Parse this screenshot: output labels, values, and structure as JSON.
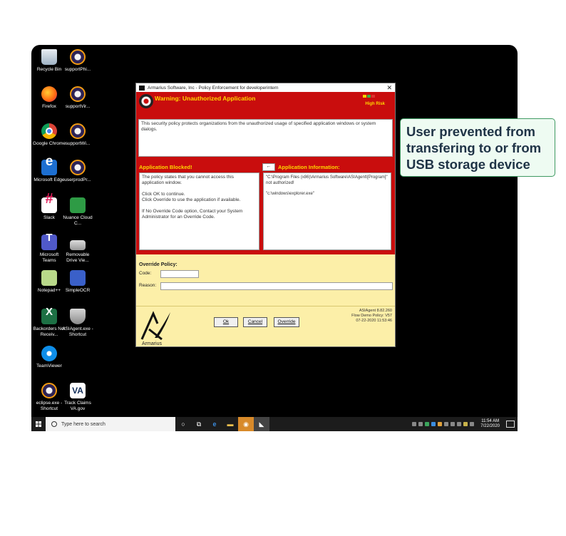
{
  "desktop": {
    "icons": [
      {
        "label": "Recycle Bin",
        "icon": "recycle-bin-icon"
      },
      {
        "label": "supportPhi...",
        "icon": "eclipse-icon"
      },
      {
        "label": "Firefox",
        "icon": "firefox-icon"
      },
      {
        "label": "supportVir...",
        "icon": "eclipse-icon"
      },
      {
        "label": "Google Chrome",
        "icon": "chrome-icon"
      },
      {
        "label": "supportWi...",
        "icon": "eclipse-icon"
      },
      {
        "label": "Microsoft Edge",
        "icon": "edge-icon"
      },
      {
        "label": "userprodPr...",
        "icon": "eclipse-icon"
      },
      {
        "label": "Slack",
        "icon": "slack-icon"
      },
      {
        "label": "Nuance Cloud C...",
        "icon": "nuance-icon"
      },
      {
        "label": "Microsoft Teams",
        "icon": "teams-icon"
      },
      {
        "label": "Removable Drive Vie...",
        "icon": "drive-icon"
      },
      {
        "label": "Notepad++",
        "icon": "notepad-icon"
      },
      {
        "label": "SimpleOCR",
        "icon": "ocr-icon"
      },
      {
        "label": "Backorders Not Receiv...",
        "icon": "excel-icon"
      },
      {
        "label": "ASIAgent.exe - Shortcut",
        "icon": "shield-icon"
      },
      {
        "label": "TeamViewer",
        "icon": "teamviewer-icon"
      },
      {
        "label": "eclipse.exe - Shortcut",
        "icon": "eclipse-icon"
      },
      {
        "label": "Track Claims VA.gov",
        "icon": "va-icon"
      }
    ]
  },
  "dialog": {
    "title": "Armarius Software, Inc - Policy Enforcement for developerintern",
    "close": "✕",
    "warning_title": "Warning: Unauthorized Application",
    "risk_label": "High Risk",
    "risk_colors": [
      "#f4d000",
      "#3cb043",
      "#e03030"
    ],
    "policy_text": "This security policy protects organizations from the unauthorized usage of specified application windows or system dialogs.",
    "blocked": {
      "header": "Application Blocked!",
      "line1": "The policy states that you cannot access this application window.",
      "line2": "Click OK to continue.",
      "line3": "Click Override to use the application if available.",
      "line4": "If No Override Code option, Contact your System Administrator for an Override Code."
    },
    "info": {
      "back": "←",
      "header": "Application Information:",
      "line1": "\"C:\\Program Files (x86)\\Armarius Software\\ASIAgent\\[Program]\" not authorized!",
      "line2": "\"c:\\windows\\explorer.exe\""
    },
    "override": {
      "header": "Override Policy:",
      "code_label": "Code:",
      "reason_label": "Reason:",
      "code_value": "",
      "reason_value": ""
    },
    "buttons": {
      "ok": "Ok",
      "cancel": "Cancel",
      "override": "Override"
    },
    "logo_text": "Armarius",
    "version": {
      "line1": "ASIAgent 8.82.260",
      "line2": "Flow Demo Policy: V57",
      "line3": "07-22-2020 11:53:46"
    }
  },
  "taskbar": {
    "search_placeholder": "Type here to search",
    "time": "11:54 AM",
    "date": "7/22/2020"
  },
  "callout": {
    "text": "User prevented from transfering to or from USB storage device"
  }
}
